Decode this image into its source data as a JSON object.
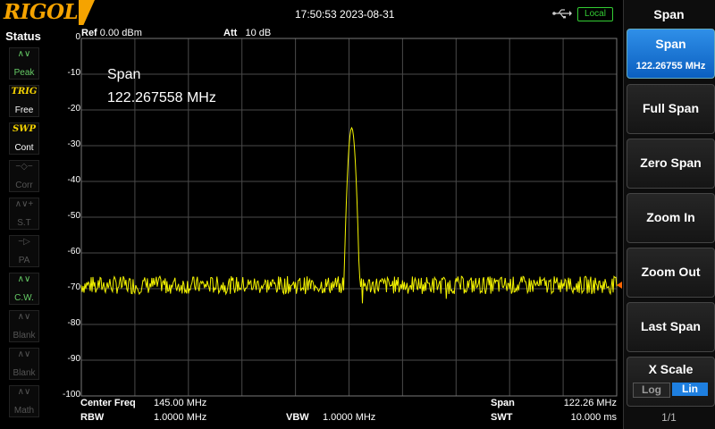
{
  "header": {
    "brand": "RIGOL",
    "datetime": "17:50:53 2023-08-31",
    "local_badge": "Local"
  },
  "status_panel": {
    "title": "Status",
    "items": [
      {
        "symbol": "∧∨",
        "label": "Peak",
        "state": "on"
      },
      {
        "symbol": "TRIG",
        "label": "Free",
        "state": "trig"
      },
      {
        "symbol": "SWP",
        "label": "Cont",
        "state": "trig"
      },
      {
        "symbol": "−◇−",
        "label": "Corr",
        "state": "off"
      },
      {
        "symbol": "∧∨+",
        "label": "S.T",
        "state": "off"
      },
      {
        "symbol": "−▷",
        "label": "PA",
        "state": "off"
      },
      {
        "symbol": "∧∨",
        "label": "C.W.",
        "state": "on"
      },
      {
        "symbol": "∧∨",
        "label": "Blank",
        "state": "off"
      },
      {
        "symbol": "∧∨",
        "label": "Blank",
        "state": "off"
      },
      {
        "symbol": "∧∨",
        "label": "Math",
        "state": "off"
      }
    ]
  },
  "plot_header": {
    "ref_label": "Ref",
    "ref_value": "0.00 dBm",
    "att_label": "Att",
    "att_value": "10 dB"
  },
  "overlay": {
    "line1": "Span",
    "line2": "122.267558 MHz"
  },
  "y_axis_labels": [
    "0",
    "-10",
    "-20",
    "-30",
    "-40",
    "-50",
    "-60",
    "-70",
    "-80",
    "-90",
    "-100"
  ],
  "footer": {
    "center_freq_label": "Center Freq",
    "center_freq_value": "145.00 MHz",
    "rbw_label": "RBW",
    "rbw_value": "1.0000 MHz",
    "vbw_label": "VBW",
    "vbw_value": "1.0000 MHz",
    "span_label": "Span",
    "span_value": "122.26 MHz",
    "swt_label": "SWT",
    "swt_value": "10.000 ms"
  },
  "menu": {
    "title": "Span",
    "buttons": [
      {
        "label": "Span",
        "sub": "122.26755 MHz",
        "active": true
      },
      {
        "label": "Full Span"
      },
      {
        "label": "Zero Span"
      },
      {
        "label": "Zoom In"
      },
      {
        "label": "Zoom Out"
      },
      {
        "label": "Last Span"
      },
      {
        "label": "X Scale"
      }
    ],
    "x_scale_options": [
      "Log",
      "Lin"
    ],
    "x_scale_selected": "Lin",
    "page_indicator": "1/1"
  },
  "chart_data": {
    "type": "line",
    "ylim": [
      -100,
      0
    ],
    "noise_floor_db": -69,
    "peak_db": -25,
    "trace_color": "#f5f500",
    "grid_color": "#4a4a4a"
  },
  "colors": {
    "brand": "#f5a300",
    "menu_active": "#1e7fe0",
    "trace": "#f5f500",
    "status_on": "#66cc66"
  }
}
